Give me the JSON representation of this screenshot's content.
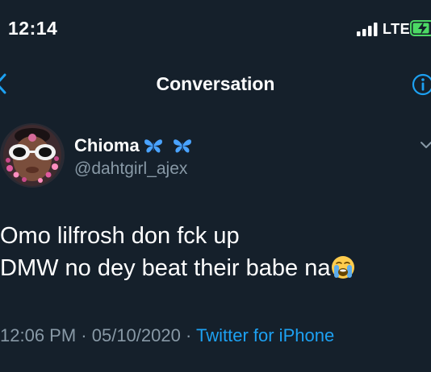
{
  "status_bar": {
    "time": "12:14",
    "network": "LTE"
  },
  "nav": {
    "title": "Conversation"
  },
  "tweet": {
    "author_name": "Chioma",
    "author_handle": "@dahtgirl_ajex",
    "name_icons": [
      "butterfly-icon",
      "butterfly-icon"
    ],
    "body_line1": "Omo lilfrosh don fck up",
    "body_line2": "DMW no dey beat their babe na",
    "body_emoji": "loudly-crying-face-icon",
    "time": "12:06 PM",
    "separator1": " · ",
    "date": "05/10/2020",
    "separator2": " · ",
    "source": "Twitter for iPhone"
  },
  "colors": {
    "background": "#15202b",
    "secondary_text": "#8899a6",
    "accent": "#1da1f2",
    "battery_charging": "#4cd964"
  }
}
